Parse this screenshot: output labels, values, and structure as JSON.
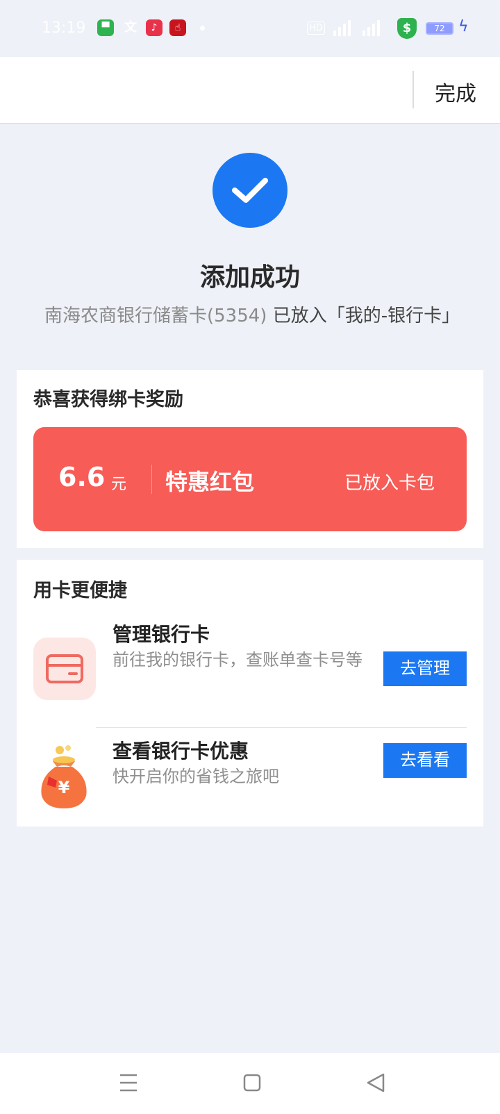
{
  "status_bar": {
    "time": "13:19",
    "hd_label": "HD",
    "battery": "72",
    "shield_symbol": "$",
    "icons": [
      "messages-app-icon",
      "translate-icon",
      "music-app-icon",
      "red-app-icon",
      "signal-icon",
      "signal-icon",
      "shield-icon",
      "battery-icon",
      "charging-icon"
    ]
  },
  "header": {
    "done_label": "完成"
  },
  "success": {
    "title": "添加成功",
    "card_name": "南海农商银行储蓄卡(5354)",
    "placed_text": "已放入「我的-银行卡」"
  },
  "reward": {
    "title": "恭喜获得绑卡奖励",
    "amount": "6.6",
    "unit": "元",
    "coupon_name": "特惠红包",
    "coupon_status": "已放入卡包",
    "coupon_color": "#f75c57"
  },
  "quick": {
    "title": "用卡更便捷",
    "items": [
      {
        "title": "管理银行卡",
        "subtitle": "前往我的银行卡，查账单查卡号等",
        "button": "去管理"
      },
      {
        "title": "查看银行卡优惠",
        "subtitle": "快开启你的省钱之旅吧",
        "button": "去看看"
      }
    ]
  },
  "colors": {
    "accent": "#1b78f2",
    "background": "#eef1f7"
  }
}
